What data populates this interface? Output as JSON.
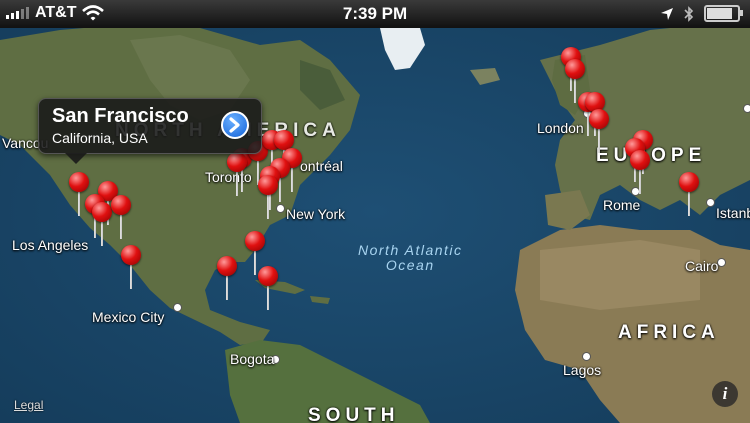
{
  "status_bar": {
    "carrier": "AT&T",
    "time": "7:39 PM",
    "battery_level": 0.9,
    "icons": [
      "signal-bars-icon",
      "wifi-icon",
      "location-arrow-icon",
      "bluetooth-icon",
      "battery-icon"
    ]
  },
  "map": {
    "region_labels": {
      "north_america": "NORTH AMERICA",
      "europe": "EUROPE",
      "africa": "AFRICA",
      "south": "SOUTH"
    },
    "ocean_label": {
      "line1": "North Atlantic",
      "line2": "Ocean"
    },
    "cities": {
      "vancouver": "Vancou",
      "los_angeles": "Los Angeles",
      "mexico_city": "Mexico City",
      "toronto": "Toronto",
      "montreal": "ontréal",
      "new_york": "New York",
      "bogota": "Bogota",
      "london": "London",
      "rome": "Rome",
      "istanbul": "Istanbu",
      "cairo": "Cairo",
      "lagos": "Lagos"
    },
    "pin_count": 34,
    "colors": {
      "ocean": "#1b4a6e",
      "land": "#5d6d43",
      "pin": "#e01010",
      "callout": "#191919"
    }
  },
  "callout": {
    "title": "San Francisco",
    "subtitle": "California, USA"
  },
  "legal": "Legal",
  "info_button": "i"
}
